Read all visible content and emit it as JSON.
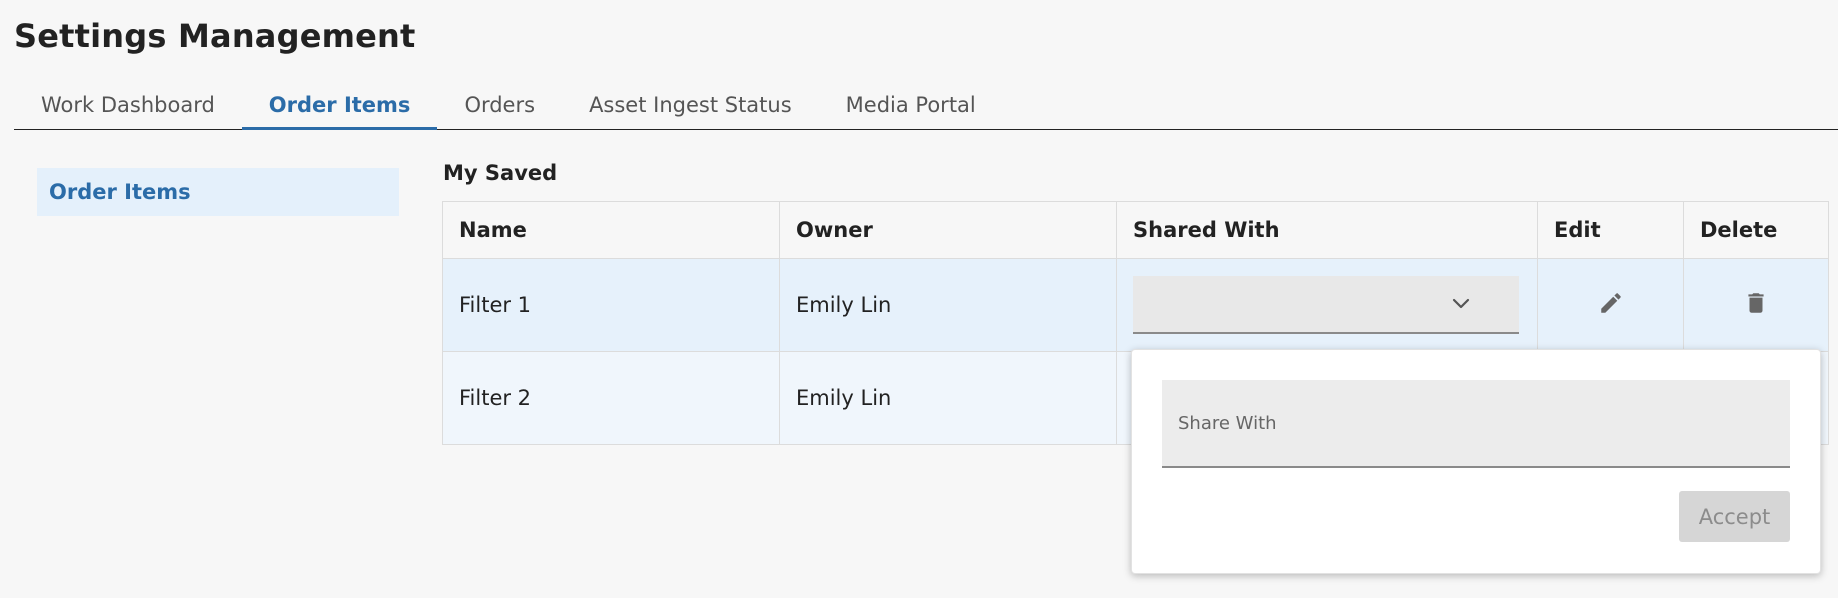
{
  "page": {
    "title": "Settings Management"
  },
  "tabs": [
    {
      "label": "Work Dashboard",
      "active": false
    },
    {
      "label": "Order Items",
      "active": true
    },
    {
      "label": "Orders",
      "active": false
    },
    {
      "label": "Asset Ingest Status",
      "active": false
    },
    {
      "label": "Media Portal",
      "active": false
    }
  ],
  "sidebar": {
    "items": [
      {
        "label": "Order Items",
        "active": true
      }
    ]
  },
  "saved": {
    "title": "My Saved",
    "columns": [
      "Name",
      "Owner",
      "Shared With",
      "Edit",
      "Delete"
    ],
    "rows": [
      {
        "name": "Filter 1",
        "owner": "Emily Lin",
        "shared_with": ""
      },
      {
        "name": "Filter 2",
        "owner": "Emily Lin",
        "shared_with": ""
      }
    ]
  },
  "popover": {
    "share_placeholder": "Share With",
    "share_value": "",
    "accept_label": "Accept"
  },
  "icons": {
    "dropdown": "chevron-down-icon",
    "edit": "pencil-icon",
    "delete": "trash-icon"
  },
  "colors": {
    "accent": "#2b6ca8",
    "selected_row": "#e6f1fb",
    "sidebar_active_bg": "#e4f0fb"
  }
}
